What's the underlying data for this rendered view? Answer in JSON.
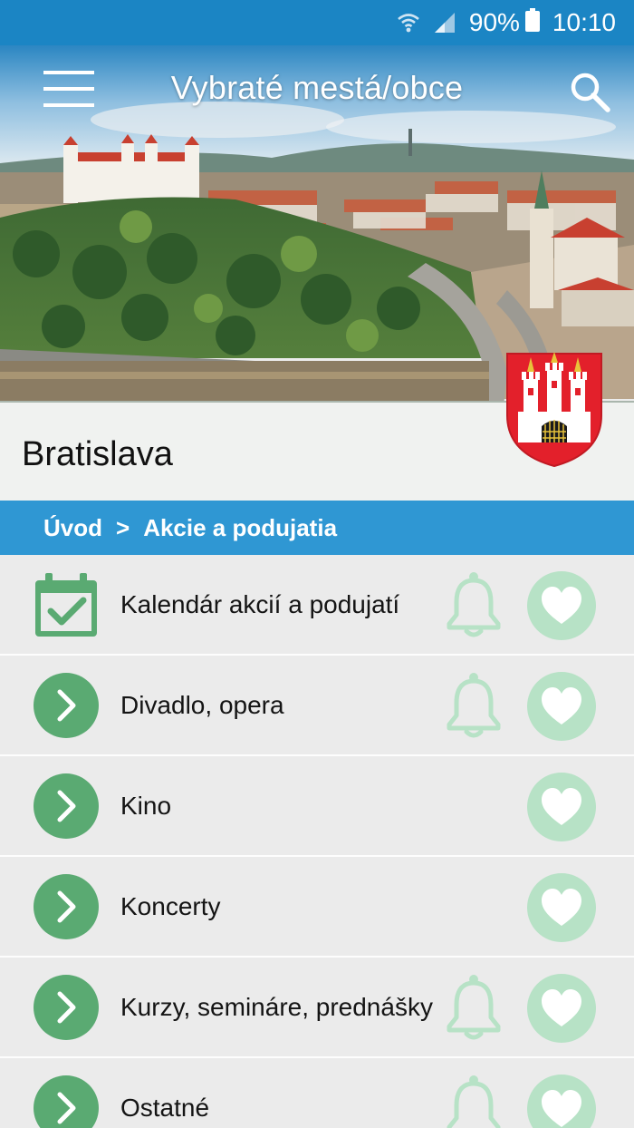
{
  "status_bar": {
    "battery": "90%",
    "time": "10:10"
  },
  "app_bar": {
    "title": "Vybraté mestá/obce"
  },
  "header": {
    "city": "Bratislava"
  },
  "breadcrumb": {
    "home": "Úvod",
    "separator": ">",
    "current": "Akcie a podujatia"
  },
  "colors": {
    "accent_blue": "#2f97d3",
    "status_blue": "#1b85c4",
    "green": "#5aaa72",
    "light_green": "#b7e2c6"
  },
  "list": [
    {
      "label": "Kalendár akcií a podujatí",
      "icon": "calendar-check-icon",
      "bell": true
    },
    {
      "label": "Divadlo, opera",
      "icon": "chevron-right-icon",
      "bell": true
    },
    {
      "label": "Kino",
      "icon": "chevron-right-icon",
      "bell": false
    },
    {
      "label": "Koncerty",
      "icon": "chevron-right-icon",
      "bell": false
    },
    {
      "label": "Kurzy, semináre, prednášky",
      "icon": "chevron-right-icon",
      "bell": true
    },
    {
      "label": "Ostatné",
      "icon": "chevron-right-icon",
      "bell": true
    }
  ]
}
